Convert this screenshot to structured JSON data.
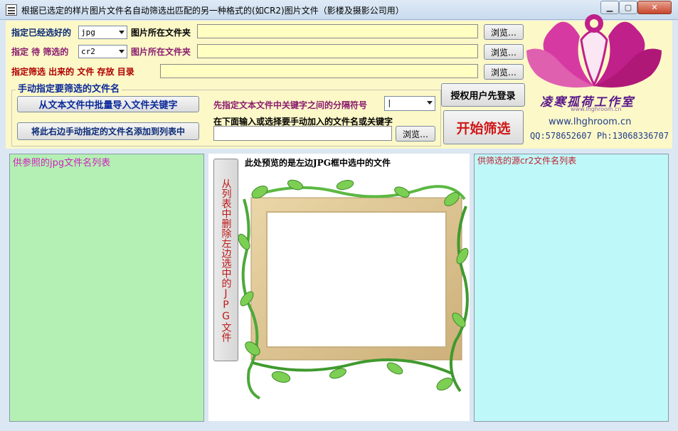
{
  "window": {
    "title": "根据已选定的样片图片文件名自动筛选出匹配的另一种格式的(如CR2)图片文件（影楼及摄影公司用）",
    "controls": {
      "minimize": "▁",
      "maximize": "▢",
      "close": "✕"
    }
  },
  "form": {
    "row1": {
      "label": "指定已经选好的",
      "format_value": "jpg",
      "folder_label": "图片所在文件夹",
      "folder_value": "",
      "browse_label": "浏览…"
    },
    "row2": {
      "label": "指定 待 筛选的",
      "format_value": "cr2",
      "folder_label": "图片所在文件夹",
      "folder_value": "",
      "browse_label": "浏览…"
    },
    "row3": {
      "label": "指定筛选 出来的 文件 存放 目录",
      "folder_value": "",
      "browse_label": "浏览…"
    }
  },
  "manual_group": {
    "title": "手动指定要筛选的文件名",
    "import_button": "从文本文件中批量导入文件关键字",
    "add_button": "将此右边手动指定的文件名添加到列表中",
    "separator_label": "先指定文本文件中关键字之间的分隔符号",
    "separator_value": "|",
    "input_label": "在下面输入或选择要手动加入的文件名或关键字",
    "input_value": "",
    "browse_label": "浏览…"
  },
  "actions": {
    "login": "授权用户先登录",
    "start": "开始筛选"
  },
  "brand": {
    "name": "凌寒孤荷工作室",
    "sub": "www.lhghroom.cn",
    "url": "www.lhghroom.cn",
    "contact": "QQ:578652607 Ph:13068336707",
    "colors": {
      "petal": "#c0208a",
      "petal_light": "#e060b0",
      "name": "#5a1a8a"
    }
  },
  "panels": {
    "left_list_header": "供参照的jpg文件名列表",
    "right_list_header": "供筛选的源cr2文件名列表",
    "preview_caption": "此处预览的是左边JPG框中选中的文件",
    "delete_button": "从列表中删除左边选中的JPG文件"
  },
  "colors": {
    "upper_bg": "#fcf8c8",
    "field_bg": "#ffffc2",
    "left_list_bg": "#b4f0b4",
    "right_list_bg": "#bff8f8"
  }
}
